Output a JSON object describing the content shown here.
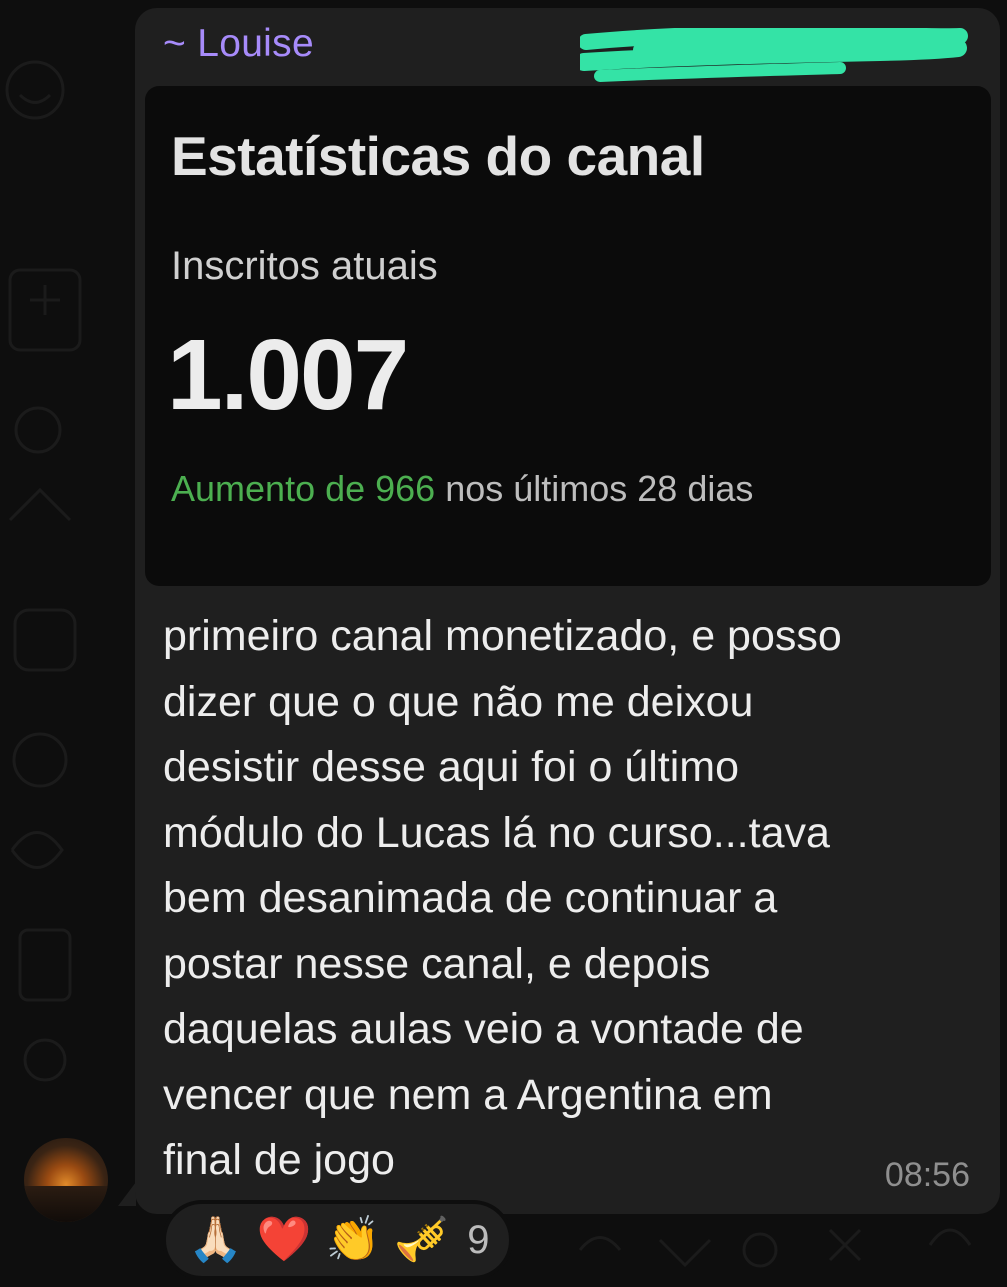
{
  "message": {
    "sender_name": "~ Louise",
    "card": {
      "title": "Estatísticas do canal",
      "subtitle": "Inscritos atuais",
      "count": "1.007",
      "growth_highlight": "Aumento de 966",
      "growth_rest": " nos últimos 28 dias"
    },
    "text": "primeiro canal monetizado, e posso\ndizer que o que não me deixou\ndesistir desse aqui foi o último\nmódulo do Lucas lá no curso...tava\nbem desanimada de continuar a\npostar nesse canal, e depois\ndaquelas aulas veio a vontade de\nvencer que nem a Argentina em\nfinal de jogo",
    "timestamp": "08:56"
  },
  "reactions": {
    "emojis": [
      "🙏🏻",
      "❤️",
      "👏",
      "🎺"
    ],
    "count": "9"
  },
  "colors": {
    "sender_name": "#a78bfa",
    "growth_highlight": "#4caf50",
    "redaction_marker": "#34e3a6",
    "bubble": "#1f1f1f",
    "background": "#0e0e0e"
  },
  "icons": [
    "avatar",
    "folded-hands-emoji",
    "heart-emoji",
    "clapping-hands-emoji",
    "trumpet-emoji"
  ]
}
